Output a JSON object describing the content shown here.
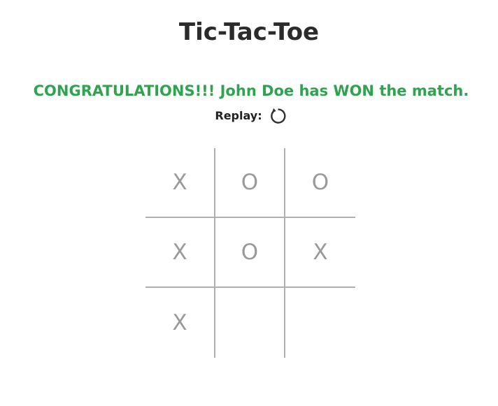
{
  "title": "Tic-Tac-Toe",
  "status": {
    "message": "CONGRATULATIONS!!! John Doe has WON the match.",
    "color": "#2ea44f"
  },
  "replay": {
    "label": "Replay:",
    "icon": "refresh-icon"
  },
  "board": {
    "cells": [
      "X",
      "O",
      "O",
      "X",
      "O",
      "X",
      "X",
      "",
      ""
    ]
  }
}
